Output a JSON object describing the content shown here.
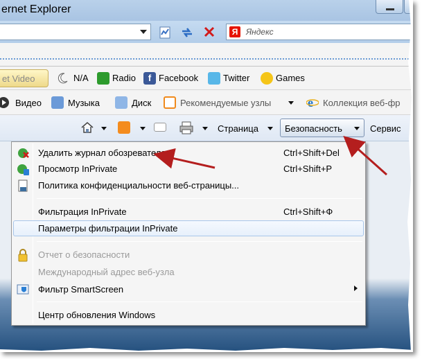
{
  "window": {
    "title": "ernet Explorer"
  },
  "search": {
    "placeholder": "Яндекс",
    "provider_logo": "Я"
  },
  "toolbar1": {
    "get_video": "et Video",
    "items": [
      {
        "icon": "moon-icon",
        "label": "N/A"
      },
      {
        "icon": "radio-icon",
        "label": "Radio"
      },
      {
        "icon": "facebook-icon",
        "label": "Facebook"
      },
      {
        "icon": "twitter-icon",
        "label": "Twitter"
      },
      {
        "icon": "games-icon",
        "label": "Games"
      }
    ]
  },
  "toolbar2": {
    "items": [
      {
        "icon": "video-icon",
        "label": "Видео"
      },
      {
        "icon": "music-icon",
        "label": "Музыка"
      },
      {
        "icon": "disk-icon",
        "label": "Диск"
      },
      {
        "icon": "suggested-sites-icon",
        "label": "Рекомендуемые узлы"
      },
      {
        "icon": "ie-icon",
        "label": "Коллекция веб-фр"
      }
    ]
  },
  "cmdbar": {
    "page": "Страница",
    "security": "Безопасность",
    "service": "Сервис"
  },
  "menu": {
    "items": [
      {
        "label": "Удалить журнал обозревателя...",
        "shortcut": "Ctrl+Shift+Del",
        "icon": "delete-history-icon",
        "enabled": true
      },
      {
        "label": "Просмотр InPrivate",
        "shortcut": "Ctrl+Shift+P",
        "icon": "inprivate-icon",
        "enabled": true
      },
      {
        "label": "Политика конфиденциальности веб-страницы...",
        "shortcut": "",
        "icon": "privacy-policy-icon",
        "enabled": true
      },
      {
        "label": "Фильтрация InPrivate",
        "shortcut": "Ctrl+Shift+Ф",
        "icon": "",
        "enabled": true
      },
      {
        "label": "Параметры фильтрации InPrivate",
        "shortcut": "",
        "icon": "",
        "enabled": true
      },
      {
        "label": "Отчет о безопасности",
        "shortcut": "",
        "icon": "lock-icon",
        "enabled": false
      },
      {
        "label": "Международный адрес веб-узла",
        "shortcut": "",
        "icon": "",
        "enabled": false
      },
      {
        "label": "Фильтр SmartScreen",
        "shortcut": "",
        "icon": "smartscreen-icon",
        "enabled": true
      },
      {
        "label": "Центр обновления Windows",
        "shortcut": "",
        "icon": "",
        "enabled": true
      }
    ]
  },
  "colors": {
    "arrow": "#b41e1e",
    "highlight": "#e7f0fb"
  }
}
